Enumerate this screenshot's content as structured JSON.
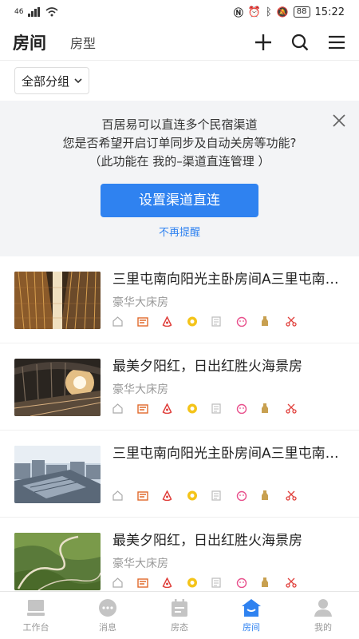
{
  "status_bar": {
    "signal": "46",
    "battery": "88",
    "time": "15:22"
  },
  "header": {
    "title": "房间",
    "tab_room_type": "房型"
  },
  "filter": {
    "label": "全部分组"
  },
  "banner": {
    "line1": "百居易可以直连多个民宿渠道",
    "line2": "您是否希望开启订单同步及自动关房等功能?",
    "line3": "（此功能在 我的–渠道直连管理 ）",
    "button": "设置渠道直连",
    "dismiss": "不再提醒"
  },
  "rooms": [
    {
      "title": "三里屯南向阳光主卧房间A三里屯南向阳光主卧房间A",
      "type": "豪华大床房",
      "image": "buildings"
    },
    {
      "title": "最美夕阳红，日出红胜火海景房",
      "type": "豪华大床房",
      "image": "station"
    },
    {
      "title": "三里屯南向阳光主卧房间A三里屯南向阳光主卧房间A",
      "type": "",
      "image": "city"
    },
    {
      "title": "最美夕阳红，日出红胜火海景房",
      "type": "豪华大床房",
      "image": "valley"
    }
  ],
  "channel_icons": [
    "home-icon",
    "ctrip-icon",
    "airbnb-icon",
    "meituan-icon",
    "doc-icon",
    "pig-icon",
    "bottle-icon",
    "scissors-icon"
  ],
  "nav": [
    {
      "label": "工作台",
      "icon": "workbench-icon"
    },
    {
      "label": "消息",
      "icon": "message-icon"
    },
    {
      "label": "房态",
      "icon": "calendar-icon"
    },
    {
      "label": "房间",
      "icon": "house-icon",
      "active": true
    },
    {
      "label": "我的",
      "icon": "user-icon"
    }
  ],
  "colors": {
    "accent": "#2f82f0",
    "banner_bg": "#f3f4f6"
  }
}
